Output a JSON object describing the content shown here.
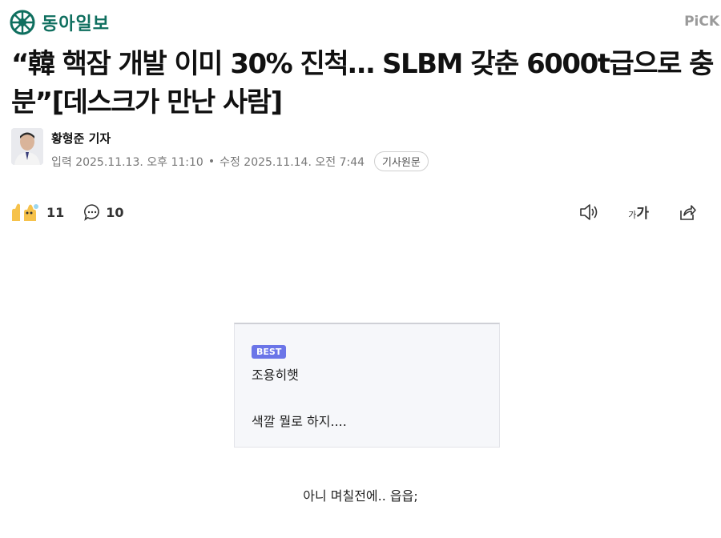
{
  "brand": {
    "name": "동아일보",
    "pick_label": "PiCK",
    "color": "#0f6f5f"
  },
  "article": {
    "headline": "“韓 핵잠 개발 이미 30% 진척… SLBM 갖춘 6000t급으로 충분”[데스크가 만난 사람]",
    "author": "황형준 기자",
    "input_date": "입력 2025.11.13. 오후 11:10",
    "separator": "•",
    "edit_date": "수정 2025.11.14. 오전 7:44",
    "original_button": "기사원문"
  },
  "toolbar": {
    "reaction_count": "11",
    "comment_count": "10",
    "font_size_small": "가",
    "font_size_large": "가"
  },
  "comment": {
    "badge": "BEST",
    "author": "조용히햇",
    "body": "색깔 뭘로 하지...."
  },
  "caption": "아니 며칠전에.. 읍읍;",
  "icons": [
    "brand-logo-icon",
    "clap-icon",
    "comment-icon",
    "speaker-icon",
    "font-size-icon",
    "share-icon"
  ]
}
